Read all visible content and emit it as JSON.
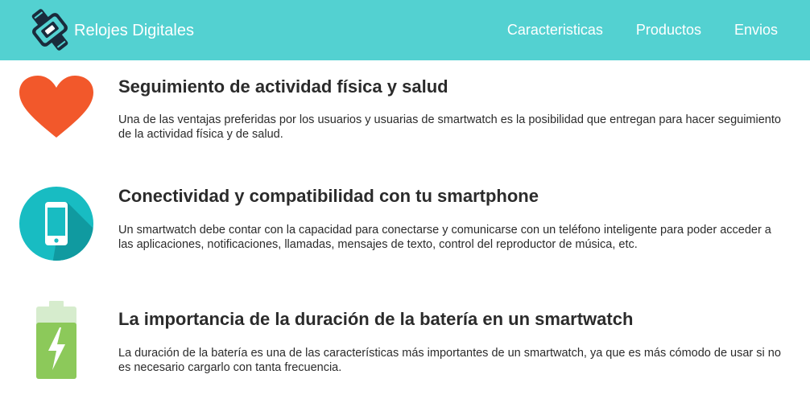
{
  "header": {
    "brand_name": "Relojes Digitales",
    "brand_icon": "smartwatch-icon",
    "nav": [
      {
        "label": "Caracteristicas"
      },
      {
        "label": "Productos"
      },
      {
        "label": "Envios"
      }
    ],
    "background_color": "#53d1d1"
  },
  "features": [
    {
      "icon": "heart-icon",
      "title": "Seguimiento de actividad física y salud",
      "text": "Una de las ventajas preferidas por los usuarios y usuarias de smartwatch es la posibilidad que entregan para hacer seguimiento de la actividad física y de salud."
    },
    {
      "icon": "smartphone-icon",
      "title": "Conectividad y compatibilidad con tu smartphone",
      "text": "Un smartwatch debe contar con la capacidad para conectarse y comunicarse con un teléfono inteligente para poder acceder a las aplicaciones, notificaciones, llamadas, mensajes de texto, control del reproductor de música, etc."
    },
    {
      "icon": "battery-icon",
      "title": "La importancia de la duración de la batería en un smartwatch",
      "text": "La duración de la batería es una de las características más importantes de un smartwatch, ya que es más cómodo de usar si no es necesario cargarlo con tanta frecuencia."
    }
  ],
  "colors": {
    "heart": "#f2582b",
    "phone_circle": "#18bcc2",
    "battery_light": "#d6eccd",
    "battery_green": "#8cc95a"
  }
}
